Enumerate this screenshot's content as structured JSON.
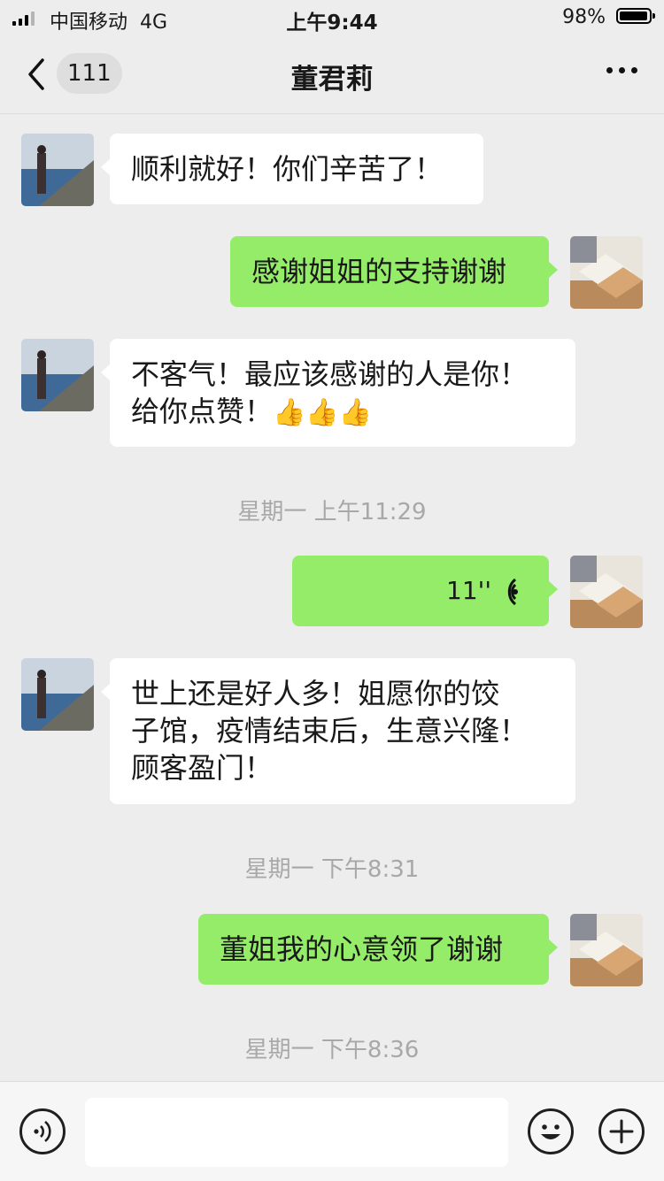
{
  "status": {
    "carrier": "中国移动",
    "network": "4G",
    "time": "上午9:44",
    "battery": "98%",
    "battery_level": 0.98
  },
  "nav": {
    "unread": "111",
    "title": "董君莉"
  },
  "messages": [
    {
      "text_lines": [
        "顺利就好！你们辛苦了！"
      ]
    },
    {
      "text_lines": [
        "感谢姐姐的支持谢谢"
      ]
    },
    {
      "text_lines": [
        "不客气！最应该感谢的人是你！",
        "给你点赞！"
      ],
      "emoji": "👍👍👍"
    },
    {
      "voice_duration": "11''"
    },
    {
      "text_lines": [
        "世上还是好人多！姐愿你的饺",
        "子馆，疫情结束后，生意兴隆！",
        "顾客盈门！"
      ]
    },
    {
      "text_lines": [
        "董姐我的心意领了谢谢"
      ]
    }
  ],
  "timestamps": [
    "星期一 上午11:29",
    "星期一 下午8:31",
    "星期一 下午8:36"
  ],
  "colors": {
    "background": "#ededed",
    "bubble_out": "#95ec69",
    "bubble_in": "#ffffff"
  },
  "icons": [
    "back-arrow-icon",
    "more-icon",
    "voice-mode-icon",
    "emoji-icon",
    "plus-icon",
    "voice-waves-icon"
  ]
}
